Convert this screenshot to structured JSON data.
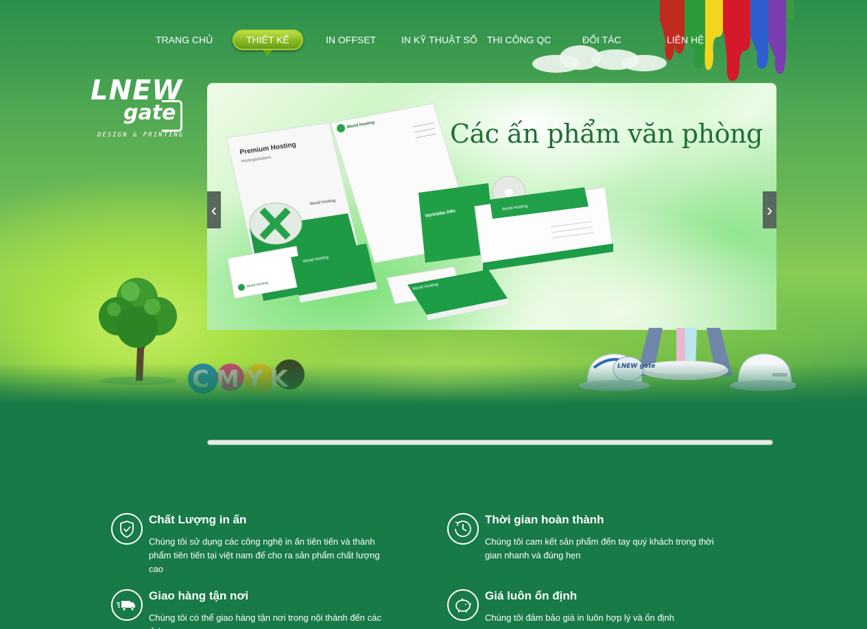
{
  "nav": {
    "items": [
      {
        "label": "TRANG CHỦ"
      },
      {
        "label": "THIẾT KẾ",
        "active": true
      },
      {
        "label": "IN OFFSET"
      },
      {
        "label": "IN KỸ THUẬT SỐ"
      },
      {
        "label": "THI CÔNG QC"
      },
      {
        "label": "ĐỐI TÁC"
      },
      {
        "label": "LIÊN HỆ"
      }
    ]
  },
  "logo": {
    "line1": "LNEW",
    "line2": "gate",
    "tagline": "DESIGN & PRINTING"
  },
  "slider": {
    "title": "Các ấn phẩm văn phòng",
    "prev_icon": "chevron-left-icon",
    "next_icon": "chevron-right-icon",
    "mockup_labels": {
      "folder_title": "Premium Hosting",
      "folder_sub": "Hostingsolutions",
      "brand": "World Hosting",
      "folder_info": "Vertriebs Info"
    }
  },
  "decor": {
    "cmyk": "CMYK",
    "machine_logo": "LNEW gate"
  },
  "progress": {
    "value": 1.0
  },
  "colors": {
    "background": "#177a47",
    "accent": "#8fbe24",
    "text": "#ffffff"
  },
  "features": [
    {
      "icon": "shield-check-icon",
      "title": "Chất Lượng in ấn",
      "desc": "Chúng tôi sử dụng các công nghệ in ấn tiên tiến và thành phẩm tiên tiến tại việt nam để cho ra sản phẩm chất lượng cao"
    },
    {
      "icon": "clock-icon",
      "title": "Thời gian hoàn thành",
      "desc": "Chúng tôi cam kết sản phẩm đến tay quý khách trong thời gian nhanh và đúng hẹn"
    },
    {
      "icon": "truck-icon",
      "title": "Giao hàng tận nơi",
      "desc": "Chúng tôi có thể giao hàng tận nơi trong nội thành đến các tỉnh"
    },
    {
      "icon": "piggy-bank-icon",
      "title": "Giá luôn ổn định",
      "desc": "Chúng tôi đảm bảo giá  in luôn hợp lý và ổn định"
    }
  ]
}
